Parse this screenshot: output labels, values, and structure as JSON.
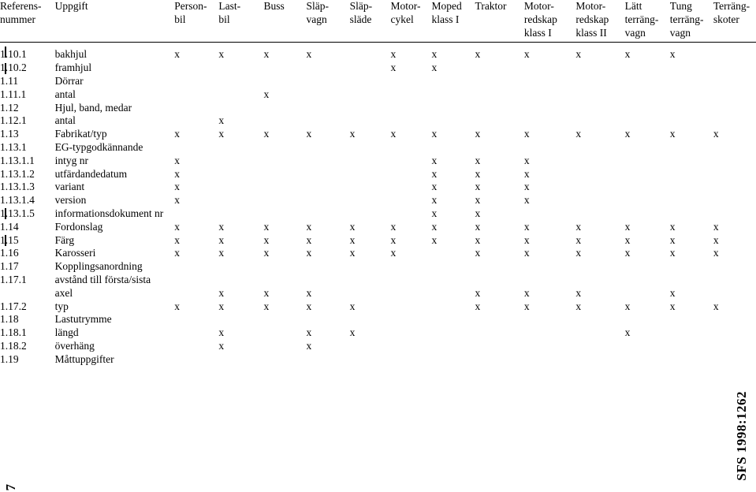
{
  "document": {
    "sfs_mark": "SFS 1998:1262",
    "page_number": "7"
  },
  "table": {
    "columns": [
      {
        "key": "ref",
        "label": "Referens-\nnummer"
      },
      {
        "key": "task",
        "label": "Uppgift"
      },
      {
        "key": "c1",
        "label": "Person-\nbil"
      },
      {
        "key": "c2",
        "label": "Last-\nbil"
      },
      {
        "key": "c3",
        "label": "Buss"
      },
      {
        "key": "c4",
        "label": "Släp-\nvagn"
      },
      {
        "key": "c5",
        "label": "Släp-\nsläde"
      },
      {
        "key": "c6",
        "label": "Motor-\ncykel"
      },
      {
        "key": "c7",
        "label": "Moped\nklass I"
      },
      {
        "key": "c8",
        "label": "Traktor"
      },
      {
        "key": "c9",
        "label": "Motor-\nredskap\nklass I"
      },
      {
        "key": "c10",
        "label": "Motor-\nredskap\nklass II"
      },
      {
        "key": "c11",
        "label": "Lätt\nterräng-\nvagn"
      },
      {
        "key": "c12",
        "label": "Tung\nterräng-\nvagn"
      },
      {
        "key": "c13",
        "label": "Terräng-\nskoter"
      }
    ],
    "mark": "x",
    "rows": [
      {
        "ref": "1.10.1",
        "task": "bakhjul",
        "changebar": true,
        "marks": [
          true,
          true,
          true,
          true,
          false,
          true,
          true,
          true,
          true,
          true,
          true,
          true,
          false
        ]
      },
      {
        "ref": "1.10.2",
        "task": "framhjul",
        "changebar": true,
        "marks": [
          false,
          false,
          false,
          false,
          false,
          true,
          true,
          false,
          false,
          false,
          false,
          false,
          false
        ]
      },
      {
        "ref": "1.11",
        "task": "Dörrar",
        "changebar": false,
        "marks": [
          false,
          false,
          false,
          false,
          false,
          false,
          false,
          false,
          false,
          false,
          false,
          false,
          false
        ]
      },
      {
        "ref": "1.11.1",
        "task": "antal",
        "changebar": false,
        "marks": [
          false,
          false,
          true,
          false,
          false,
          false,
          false,
          false,
          false,
          false,
          false,
          false,
          false
        ]
      },
      {
        "ref": "1.12",
        "task": "Hjul, band, medar",
        "changebar": false,
        "marks": [
          false,
          false,
          false,
          false,
          false,
          false,
          false,
          false,
          false,
          false,
          false,
          false,
          false
        ]
      },
      {
        "ref": "1.12.1",
        "task": "antal",
        "changebar": false,
        "marks": [
          false,
          true,
          false,
          false,
          false,
          false,
          false,
          false,
          false,
          false,
          false,
          false,
          false
        ]
      },
      {
        "ref": "1.13",
        "task": "Fabrikat/typ",
        "changebar": false,
        "marks": [
          true,
          true,
          true,
          true,
          true,
          true,
          true,
          true,
          true,
          true,
          true,
          true,
          true
        ]
      },
      {
        "ref": "1.13.1",
        "task": "EG-typgodkännande",
        "changebar": false,
        "marks": [
          false,
          false,
          false,
          false,
          false,
          false,
          false,
          false,
          false,
          false,
          false,
          false,
          false
        ]
      },
      {
        "ref": "1.13.1.1",
        "task": "intyg nr",
        "changebar": false,
        "marks": [
          true,
          false,
          false,
          false,
          false,
          false,
          true,
          true,
          true,
          false,
          false,
          false,
          false
        ]
      },
      {
        "ref": "1.13.1.2",
        "task": "utfärdandedatum",
        "changebar": false,
        "marks": [
          true,
          false,
          false,
          false,
          false,
          false,
          true,
          true,
          true,
          false,
          false,
          false,
          false
        ]
      },
      {
        "ref": "1.13.1.3",
        "task": "variant",
        "changebar": false,
        "marks": [
          true,
          false,
          false,
          false,
          false,
          false,
          true,
          true,
          true,
          false,
          false,
          false,
          false
        ]
      },
      {
        "ref": "1.13.1.4",
        "task": "version",
        "changebar": false,
        "marks": [
          true,
          false,
          false,
          false,
          false,
          false,
          true,
          true,
          true,
          false,
          false,
          false,
          false
        ]
      },
      {
        "ref": "1.13.1.5",
        "task": "informationsdokument nr",
        "changebar": true,
        "marks": [
          false,
          false,
          false,
          false,
          false,
          false,
          true,
          true,
          false,
          false,
          false,
          false,
          false
        ]
      },
      {
        "ref": "1.14",
        "task": "Fordonslag",
        "changebar": false,
        "marks": [
          true,
          true,
          true,
          true,
          true,
          true,
          true,
          true,
          true,
          true,
          true,
          true,
          true
        ]
      },
      {
        "ref": "1.15",
        "task": "Färg",
        "changebar": true,
        "marks": [
          true,
          true,
          true,
          true,
          true,
          true,
          true,
          true,
          true,
          true,
          true,
          true,
          true
        ]
      },
      {
        "ref": "1.16",
        "task": "Karosseri",
        "changebar": false,
        "marks": [
          true,
          true,
          true,
          true,
          true,
          true,
          false,
          true,
          true,
          true,
          true,
          true,
          true
        ]
      },
      {
        "ref": "1.17",
        "task": "Kopplingsanordning",
        "changebar": false,
        "marks": [
          false,
          false,
          false,
          false,
          false,
          false,
          false,
          false,
          false,
          false,
          false,
          false,
          false
        ]
      },
      {
        "ref": "1.17.1",
        "task": "avstånd till första/sista",
        "changebar": false,
        "marks": [
          false,
          false,
          false,
          false,
          false,
          false,
          false,
          false,
          false,
          false,
          false,
          false,
          false
        ]
      },
      {
        "ref": "",
        "task": "axel",
        "changebar": false,
        "marks": [
          false,
          true,
          true,
          true,
          false,
          false,
          false,
          true,
          true,
          true,
          false,
          true,
          false
        ]
      },
      {
        "ref": "1.17.2",
        "task": "typ",
        "changebar": false,
        "marks": [
          true,
          true,
          true,
          true,
          true,
          false,
          false,
          true,
          true,
          true,
          true,
          true,
          true
        ]
      },
      {
        "ref": "1.18",
        "task": "Lastutrymme",
        "changebar": false,
        "marks": [
          false,
          false,
          false,
          false,
          false,
          false,
          false,
          false,
          false,
          false,
          false,
          false,
          false
        ]
      },
      {
        "ref": "1.18.1",
        "task": "längd",
        "changebar": false,
        "marks": [
          false,
          true,
          false,
          true,
          true,
          false,
          false,
          false,
          false,
          false,
          true,
          false,
          false
        ]
      },
      {
        "ref": "1.18.2",
        "task": "överhäng",
        "changebar": false,
        "marks": [
          false,
          true,
          false,
          true,
          false,
          false,
          false,
          false,
          false,
          false,
          false,
          false,
          false
        ]
      },
      {
        "ref": "1.19",
        "task": "Måttuppgifter",
        "changebar": false,
        "marks": [
          false,
          false,
          false,
          false,
          false,
          false,
          false,
          false,
          false,
          false,
          false,
          false,
          false
        ]
      }
    ]
  }
}
